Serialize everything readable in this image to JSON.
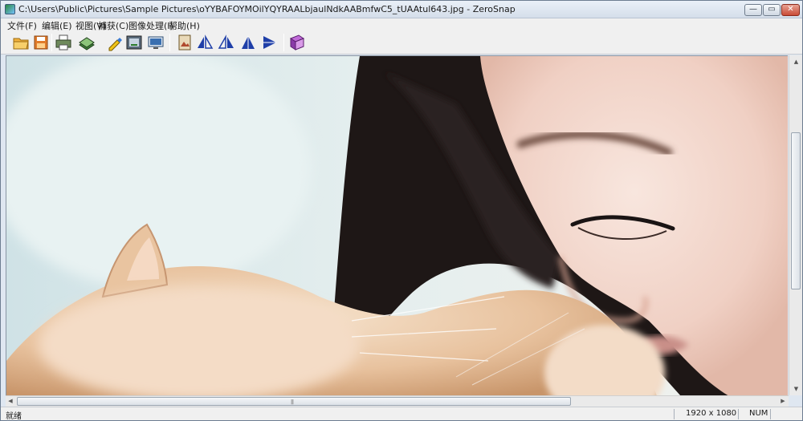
{
  "window": {
    "title": "C:\\Users\\Public\\Pictures\\Sample Pictures\\oYYBAFOYMOilYQYRAALbjaulNdkAABmfwC5_tUAAtul643.jpg - ZeroSnap",
    "minimize_glyph": "—",
    "maximize_glyph": "▭",
    "close_glyph": "✕"
  },
  "menu": {
    "items": [
      "文件(F)",
      "编辑(E)",
      "视图(V)",
      "捕获(C)",
      "图像处理(I)",
      "帮助(H)"
    ]
  },
  "toolbar": {
    "buttons": [
      "open-icon",
      "save-icon",
      "print-icon",
      "scanner-icon",
      "color-pick-icon",
      "capture-icon",
      "screen-icon",
      "image-adjust-icon",
      "flip-left-icon",
      "flip-right-icon",
      "rotate-left-icon",
      "rotate-right-icon",
      "help-book-icon"
    ]
  },
  "image": {
    "subject": "photo"
  },
  "statusbar": {
    "ready_text": "就绪",
    "dimensions": "1920 x 1080",
    "num_lock": "NUM"
  },
  "colors": {
    "frame": "#dfe7f1",
    "menu_bg": "#f0f0f0",
    "close_red": "#c94b36"
  }
}
